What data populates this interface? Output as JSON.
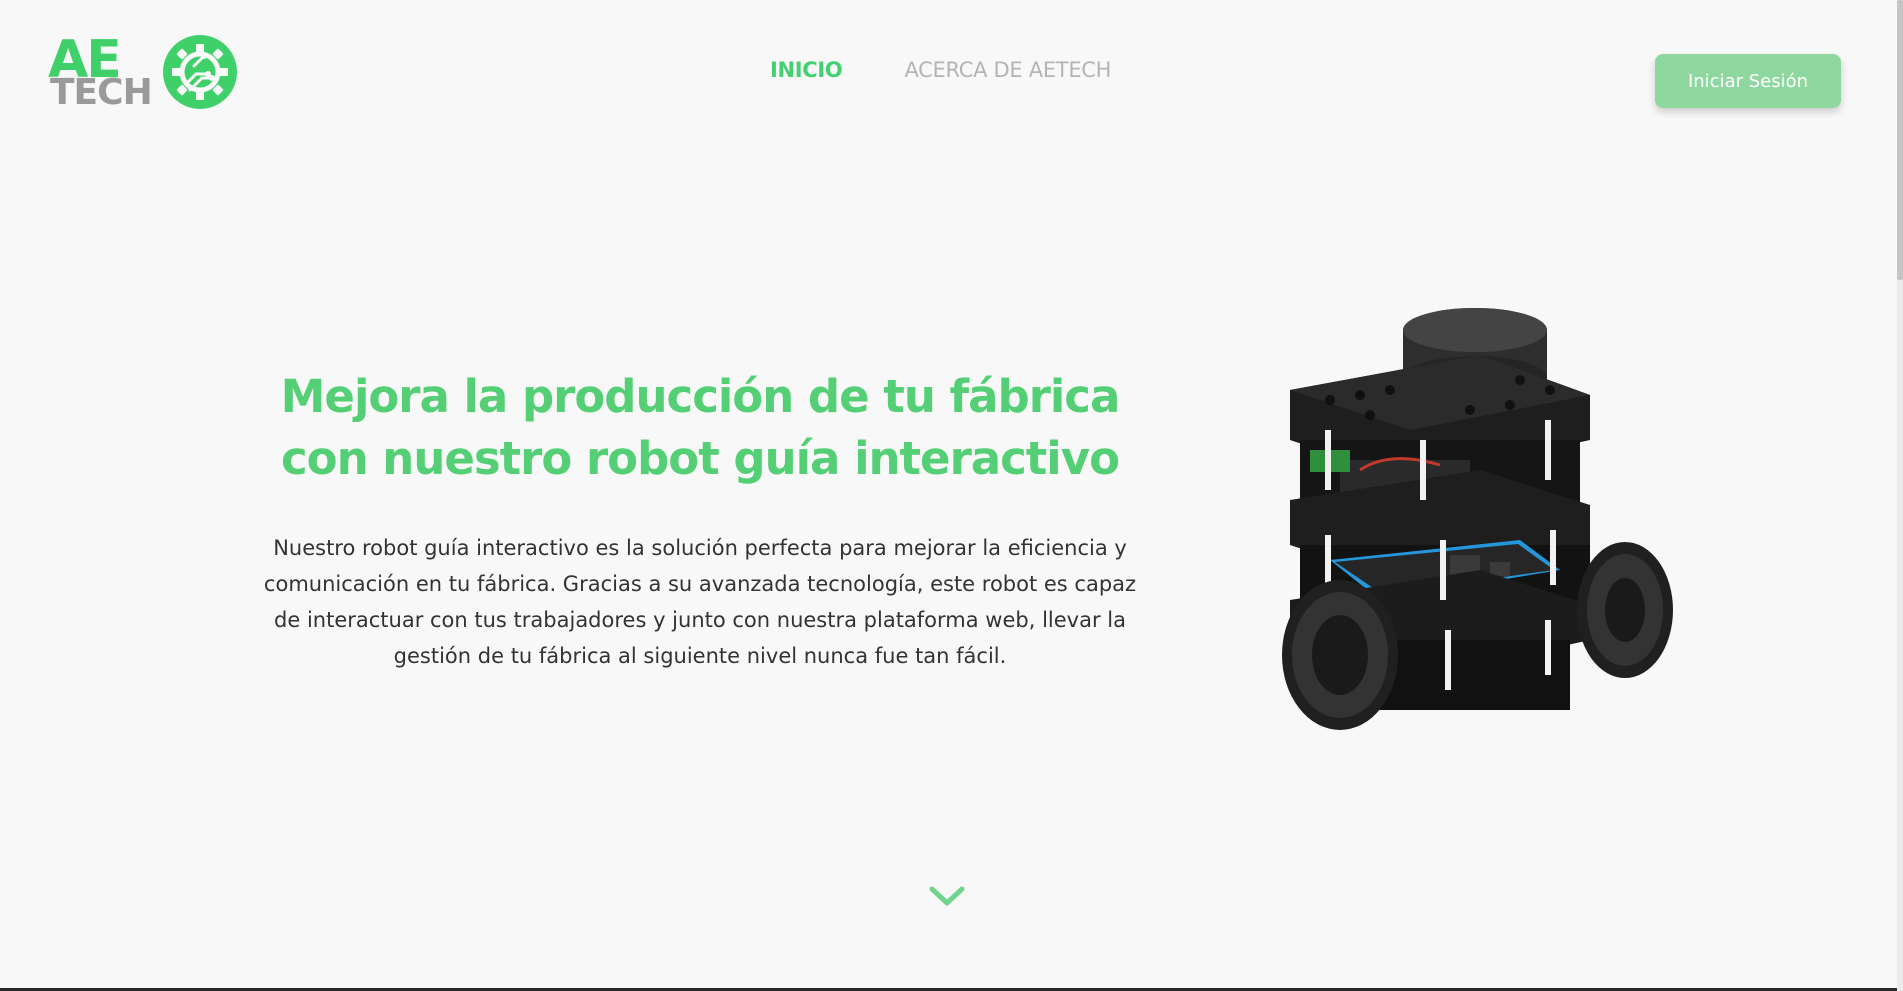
{
  "header": {
    "logo": {
      "line1": "AE",
      "line2": "TECH",
      "icon": "gear-circuit-icon"
    },
    "nav": [
      {
        "label": "INICIO",
        "active": true
      },
      {
        "label": "ACERCA DE AETECH",
        "active": false
      }
    ],
    "login_label": "Iniciar Sesión"
  },
  "hero": {
    "title": "Mejora la producción de tu fábrica con nuestro robot guía interactivo",
    "description": "Nuestro robot guía interactivo es la solución perfecta para mejorar la eficiencia y comunicación en tu fábrica. Gracias a su avanzada tecnología, este robot es capaz de interactuar con tus trabajadores y junto con nuestra plataforma web, llevar la gestión de tu fábrica al siguiente nivel nunca fue tan fácil."
  },
  "scroll_icon": "chevron-down-icon",
  "colors": {
    "accent": "#44d070",
    "title": "#55cf75",
    "button": "#8ed8a0",
    "nav_inactive": "#b4b4b4",
    "background": "#f8f8f8"
  }
}
